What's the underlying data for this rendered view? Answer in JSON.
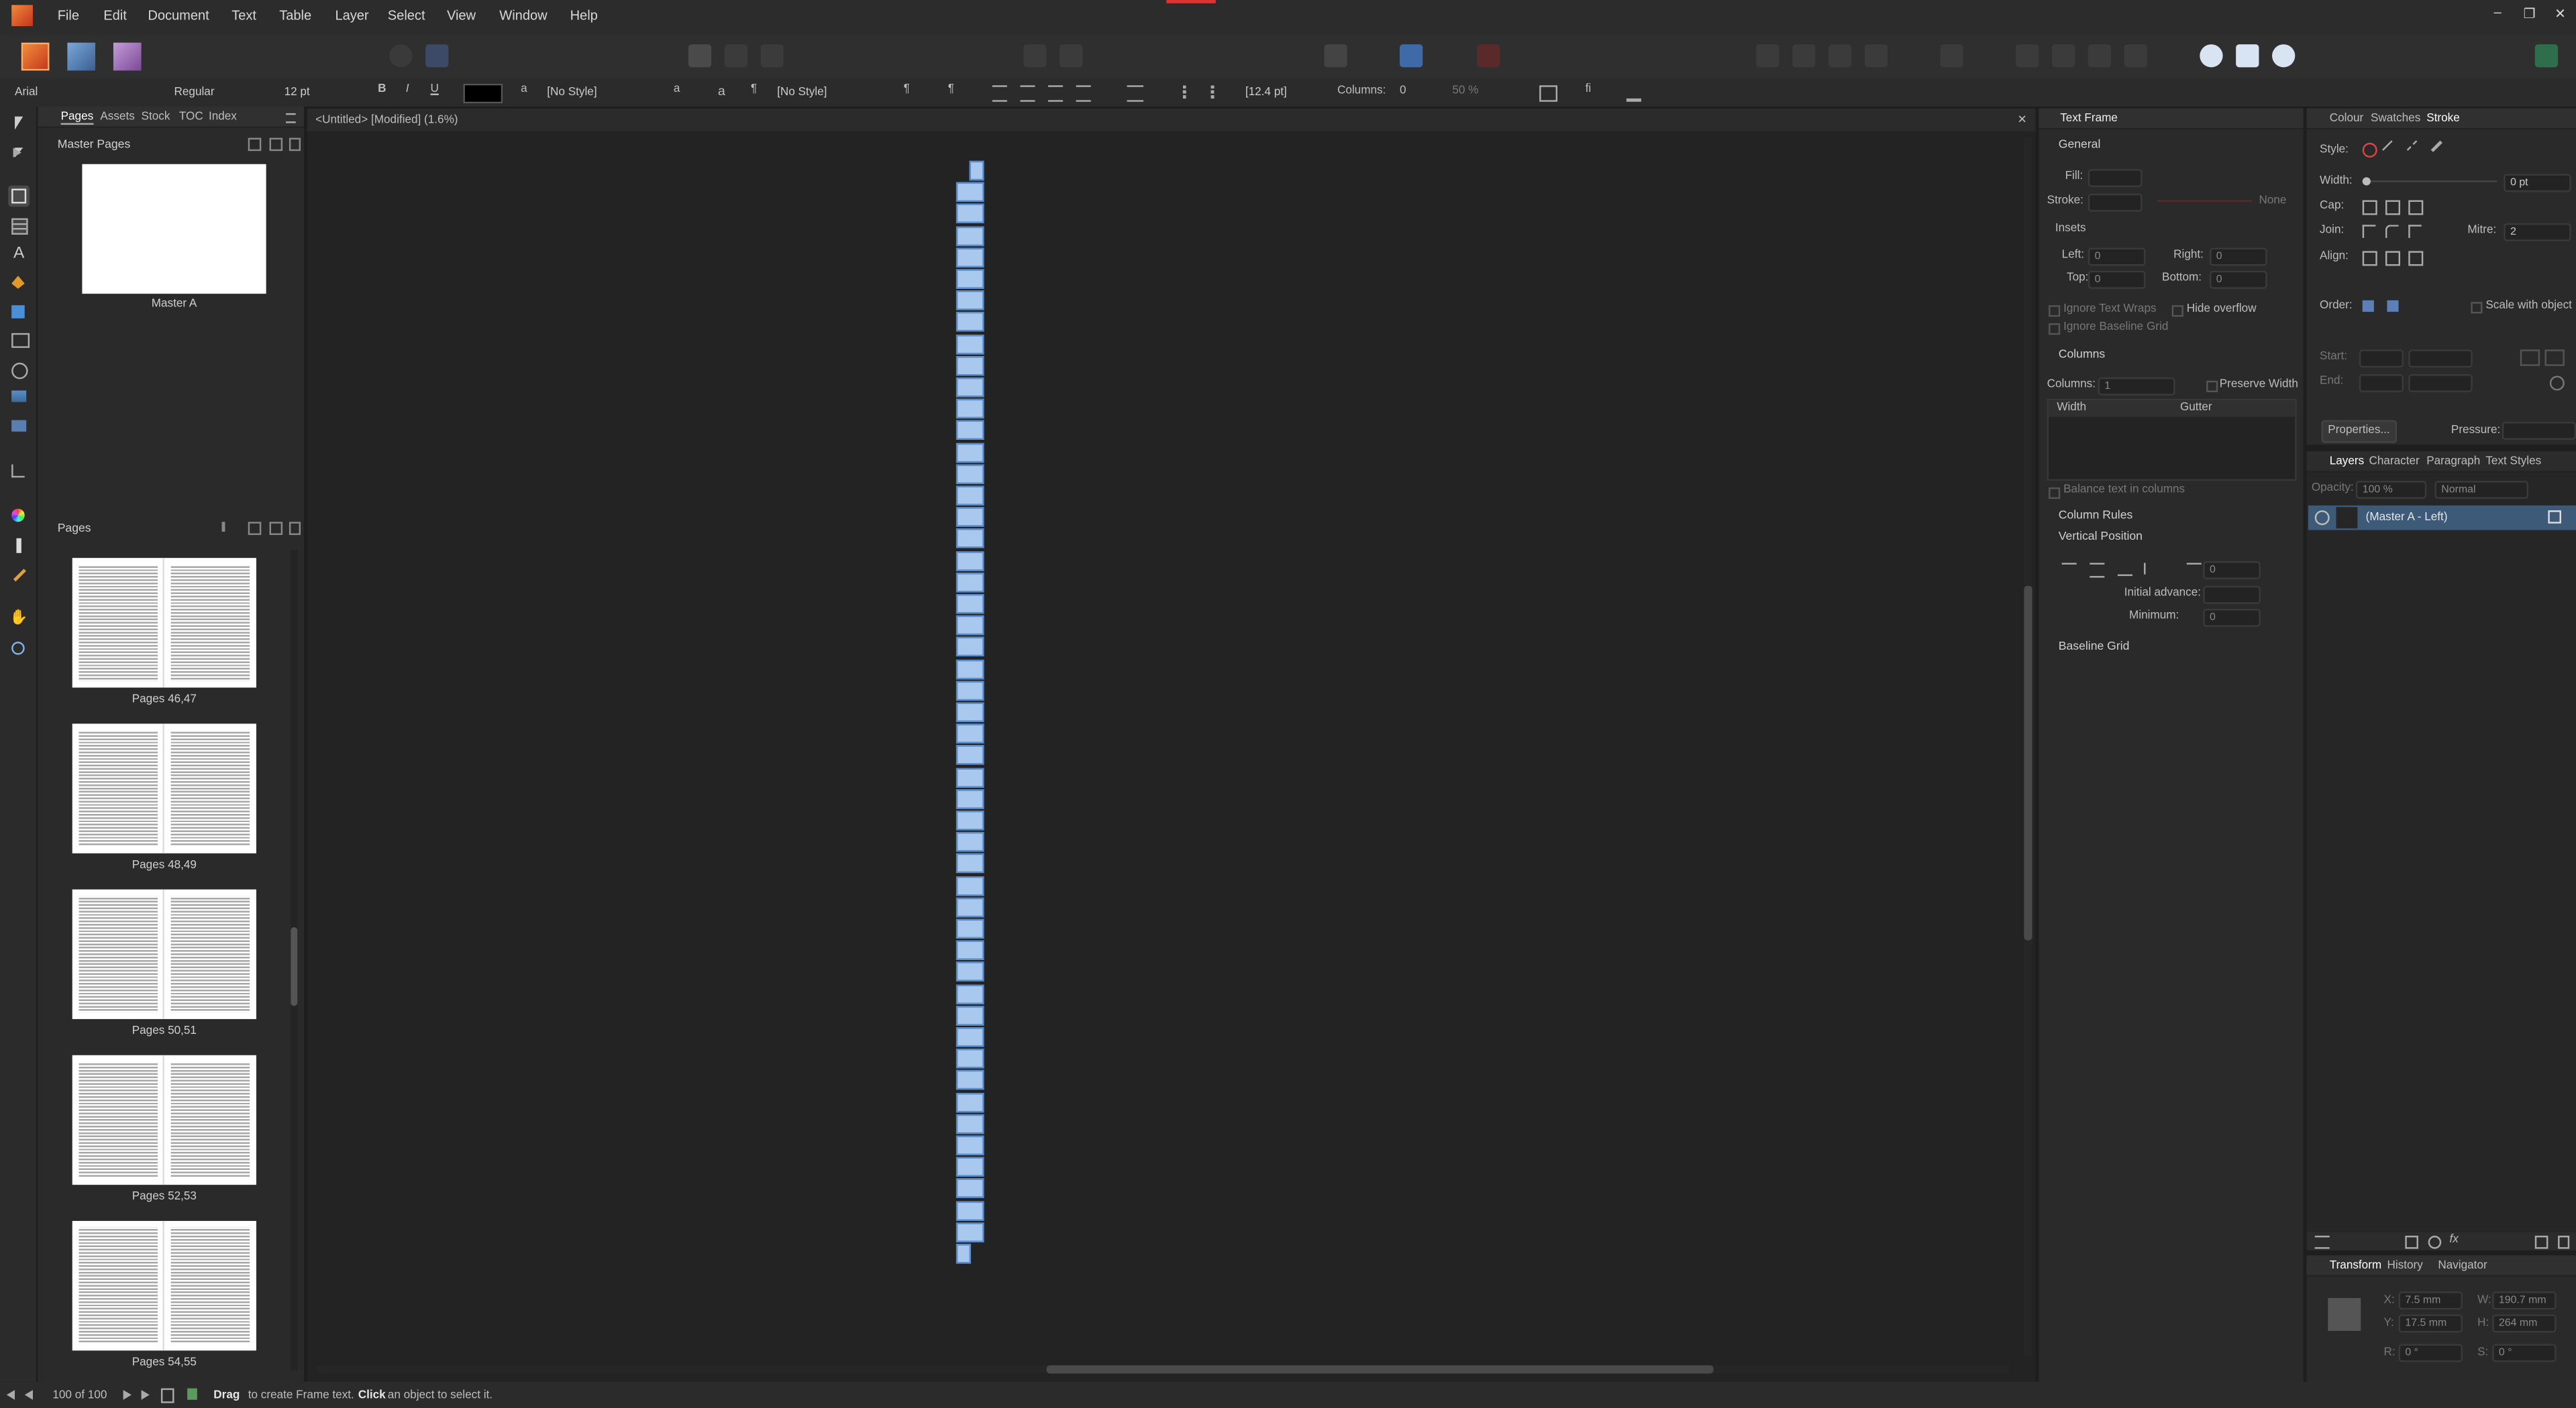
{
  "menu": [
    "File",
    "Edit",
    "Document",
    "Text",
    "Table",
    "Layer",
    "Select",
    "View",
    "Window",
    "Help"
  ],
  "window_controls": {
    "minimize": "–",
    "maximize": "❐",
    "close": "✕"
  },
  "context": {
    "font": "Arial",
    "weight": "Regular",
    "size": "12 pt",
    "bold": "B",
    "italic": "I",
    "underline": "U",
    "char_style": "[No Style]",
    "para_style": "[No Style]",
    "leading": "[12.4 pt]",
    "columns_label": "Columns:",
    "columns_value": "0",
    "zoom": "50 %",
    "a1": "a",
    "a2": "a",
    "pilcrow": "¶",
    "pilcrow2": "¶",
    "fi": "fi"
  },
  "left_tabs": [
    "Pages",
    "Assets",
    "Stock",
    "TOC",
    "Index"
  ],
  "master_pages": {
    "title": "Master Pages",
    "items": [
      {
        "label": "Master A"
      }
    ]
  },
  "pages": {
    "title": "Pages",
    "items": [
      {
        "label": "Pages 46,47"
      },
      {
        "label": "Pages 48,49"
      },
      {
        "label": "Pages 50,51"
      },
      {
        "label": "Pages 52,53"
      },
      {
        "label": "Pages 54,55"
      }
    ]
  },
  "doc_tab": {
    "title": "<Untitled> [Modified] (1.6%)",
    "close": "✕"
  },
  "text_frame": {
    "tab": "Text Frame",
    "general": "General",
    "fill": "Fill:",
    "stroke": "Stroke:",
    "stroke_value": "None",
    "insets": "Insets",
    "left": "Left:",
    "left_val": "0",
    "right": "Right:",
    "right_val": "0",
    "top": "Top:",
    "top_val": "0",
    "bottom": "Bottom:",
    "bottom_val": "0",
    "ignore_wraps": "Ignore Text Wraps",
    "hide_overflow": "Hide overflow",
    "ignore_grid": "Ignore Baseline Grid",
    "columns_header": "Columns",
    "columns": "Columns:",
    "columns_val": "1",
    "preserve_width": "Preserve Width",
    "width_col": "Width",
    "gutter_col": "Gutter",
    "balance": "Balance text in columns",
    "column_rules": "Column Rules",
    "vertical_position": "Vertical Position",
    "vp_value": "0",
    "initial_advance": "Initial advance:",
    "minimum": "Minimum:",
    "minimum_val": "0",
    "baseline_grid": "Baseline Grid"
  },
  "stroke_panel": {
    "tabs": [
      "Colour",
      "Swatches",
      "Stroke"
    ],
    "style": "Style:",
    "width": "Width:",
    "width_val": "0 pt",
    "cap": "Cap:",
    "join": "Join:",
    "mitre": "Mitre:",
    "mitre_val": "2",
    "align": "Align:",
    "order": "Order:",
    "scale_with_object": "Scale with object",
    "start": "Start:",
    "end": "End:",
    "properties": "Properties...",
    "pressure": "Pressure:"
  },
  "layers_panel": {
    "tabs": [
      "Layers",
      "Character",
      "Paragraph",
      "Text Styles"
    ],
    "opacity_label": "Opacity:",
    "opacity": "100 %",
    "blend": "Normal",
    "layer": "(Master A - Left)",
    "fx": "fx"
  },
  "transform_panel": {
    "tabs": [
      "Transform",
      "History",
      "Navigator"
    ],
    "x": "7.5 mm",
    "y": "17.5 mm",
    "w": "190.7 mm",
    "h": "264 mm",
    "r": "0 °",
    "s": "0 °",
    "x_lbl": "X:",
    "y_lbl": "Y:",
    "w_lbl": "W:",
    "h_lbl": "H:",
    "r_lbl": "R:",
    "s_lbl": "S:"
  },
  "status": {
    "page": "100 of 100",
    "hint_bold1": "Drag",
    "hint1": "to create Frame text.",
    "hint_bold2": "Click",
    "hint2": "an object to select it."
  },
  "colors": {
    "accent": "#4a90d9",
    "app_orange": "#e06a28",
    "selection": "#3d5a78",
    "strip_fill": "#a8c8ee"
  },
  "icons": [
    "affinity-publisher-icon",
    "affinity-designer-persona-icon",
    "affinity-photo-persona-icon",
    "move-tool-icon",
    "frame-text-tool-icon",
    "hand-tool-icon",
    "zoom-tool-icon",
    "layer-visibility-icon"
  ]
}
